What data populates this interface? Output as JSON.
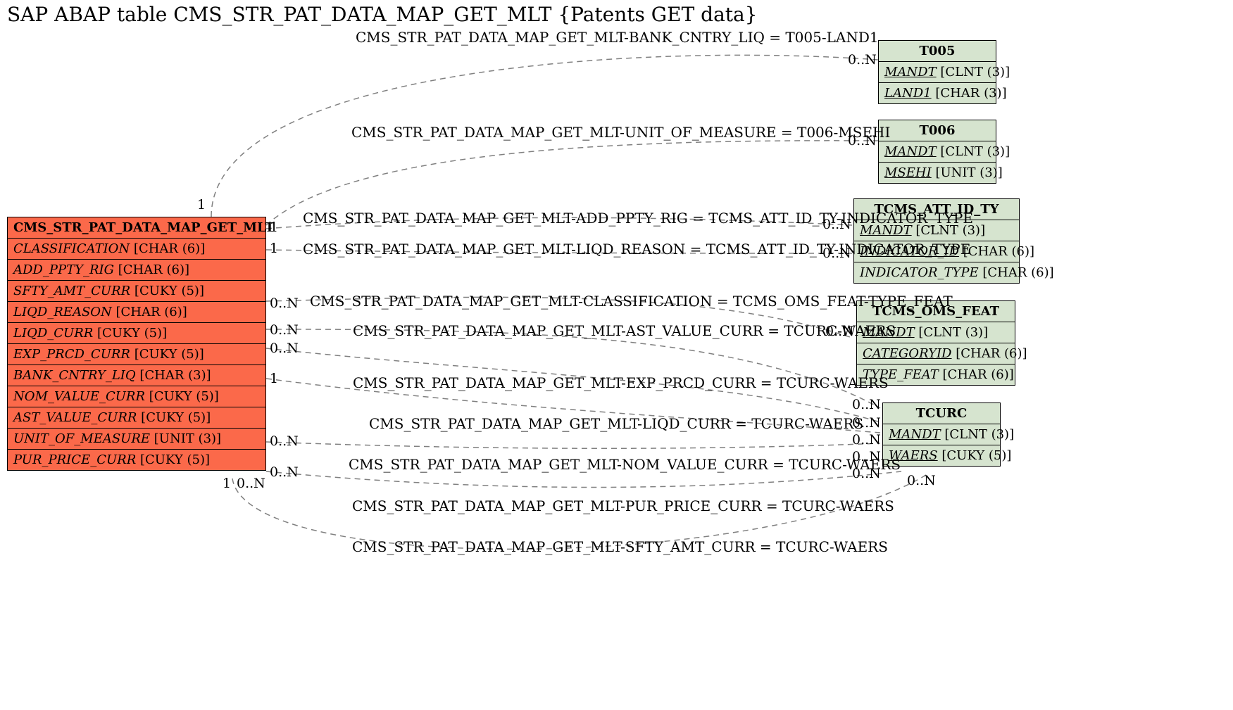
{
  "title": "SAP ABAP table CMS_STR_PAT_DATA_MAP_GET_MLT {Patents GET data}",
  "mainEntity": {
    "name": "CMS_STR_PAT_DATA_MAP_GET_MLT",
    "fields": [
      {
        "name": "CLASSIFICATION",
        "type": "[CHAR (6)]"
      },
      {
        "name": "ADD_PPTY_RIG",
        "type": "[CHAR (6)]"
      },
      {
        "name": "SFTY_AMT_CURR",
        "type": "[CUKY (5)]"
      },
      {
        "name": "LIQD_REASON",
        "type": "[CHAR (6)]"
      },
      {
        "name": "LIQD_CURR",
        "type": "[CUKY (5)]"
      },
      {
        "name": "EXP_PRCD_CURR",
        "type": "[CUKY (5)]"
      },
      {
        "name": "BANK_CNTRY_LIQ",
        "type": "[CHAR (3)]"
      },
      {
        "name": "NOM_VALUE_CURR",
        "type": "[CUKY (5)]"
      },
      {
        "name": "AST_VALUE_CURR",
        "type": "[CUKY (5)]"
      },
      {
        "name": "UNIT_OF_MEASURE",
        "type": "[UNIT (3)]"
      },
      {
        "name": "PUR_PRICE_CURR",
        "type": "[CUKY (5)]"
      }
    ]
  },
  "entities": {
    "t005": {
      "name": "T005",
      "fields": [
        {
          "name": "MANDT",
          "type": "[CLNT (3)]",
          "ul": true
        },
        {
          "name": "LAND1",
          "type": "[CHAR (3)]",
          "ul": true
        }
      ]
    },
    "t006": {
      "name": "T006",
      "fields": [
        {
          "name": "MANDT",
          "type": "[CLNT (3)]",
          "ul": true
        },
        {
          "name": "MSEHI",
          "type": "[UNIT (3)]",
          "ul": true
        }
      ]
    },
    "tcms_att": {
      "name": "TCMS_ATT_ID_TY",
      "fields": [
        {
          "name": "MANDT",
          "type": "[CLNT (3)]",
          "ul": true
        },
        {
          "name": "INDICATOR_ID",
          "type": "[CHAR (6)]",
          "ul": true
        },
        {
          "name": "INDICATOR_TYPE",
          "type": "[CHAR (6)]",
          "ul": false
        }
      ]
    },
    "tcms_oms": {
      "name": "TCMS_OMS_FEAT",
      "fields": [
        {
          "name": "MANDT",
          "type": "[CLNT (3)]",
          "ul": true
        },
        {
          "name": "CATEGORYID",
          "type": "[CHAR (6)]",
          "ul": true
        },
        {
          "name": "TYPE_FEAT",
          "type": "[CHAR (6)]",
          "ul": false
        }
      ]
    },
    "tcurc": {
      "name": "TCURC",
      "fields": [
        {
          "name": "MANDT",
          "type": "[CLNT (3)]",
          "ul": true
        },
        {
          "name": "WAERS",
          "type": "[CUKY (5)]",
          "ul": true
        }
      ]
    }
  },
  "labels": {
    "l1": "CMS_STR_PAT_DATA_MAP_GET_MLT-BANK_CNTRY_LIQ = T005-LAND1",
    "l2": "CMS_STR_PAT_DATA_MAP_GET_MLT-UNIT_OF_MEASURE = T006-MSEHI",
    "l3": "CMS_STR_PAT_DATA_MAP_GET_MLT-ADD_PPTY_RIG = TCMS_ATT_ID_TY-INDICATOR_TYPE",
    "l4": "CMS_STR_PAT_DATA_MAP_GET_MLT-LIQD_REASON = TCMS_ATT_ID_TY-INDICATOR_TYPE",
    "l5": "CMS_STR_PAT_DATA_MAP_GET_MLT-CLASSIFICATION = TCMS_OMS_FEAT-TYPE_FEAT",
    "l6": "CMS_STR_PAT_DATA_MAP_GET_MLT-AST_VALUE_CURR = TCURC-WAERS",
    "l7": "CMS_STR_PAT_DATA_MAP_GET_MLT-EXP_PRCD_CURR = TCURC-WAERS",
    "l8": "CMS_STR_PAT_DATA_MAP_GET_MLT-LIQD_CURR = TCURC-WAERS",
    "l9": "CMS_STR_PAT_DATA_MAP_GET_MLT-NOM_VALUE_CURR = TCURC-WAERS",
    "l10": "CMS_STR_PAT_DATA_MAP_GET_MLT-PUR_PRICE_CURR = TCURC-WAERS",
    "l11": "CMS_STR_PAT_DATA_MAP_GET_MLT-SFTY_AMT_CURR = TCURC-WAERS"
  },
  "cards": {
    "c_main_tl": "1",
    "c_main_b1": "1",
    "c_main_b2": "0..N",
    "c_r1": "1",
    "c_r2": "1",
    "c_r3": "0..N",
    "c_r4": "0..N",
    "c_r5": "0..N",
    "c_r6": "1",
    "c_r7": "0..N",
    "c_r8": "0..N",
    "c_t005": "0..N",
    "c_t006": "0..N",
    "c_att1": "0..N",
    "c_att2": "0..N",
    "c_oms": "0..N",
    "c_tc1": "0..N",
    "c_tc2": "0..N",
    "c_tc3": "0..N",
    "c_tc4": "0..N",
    "c_tc5": "0..N",
    "c_tc6": "0..N"
  }
}
